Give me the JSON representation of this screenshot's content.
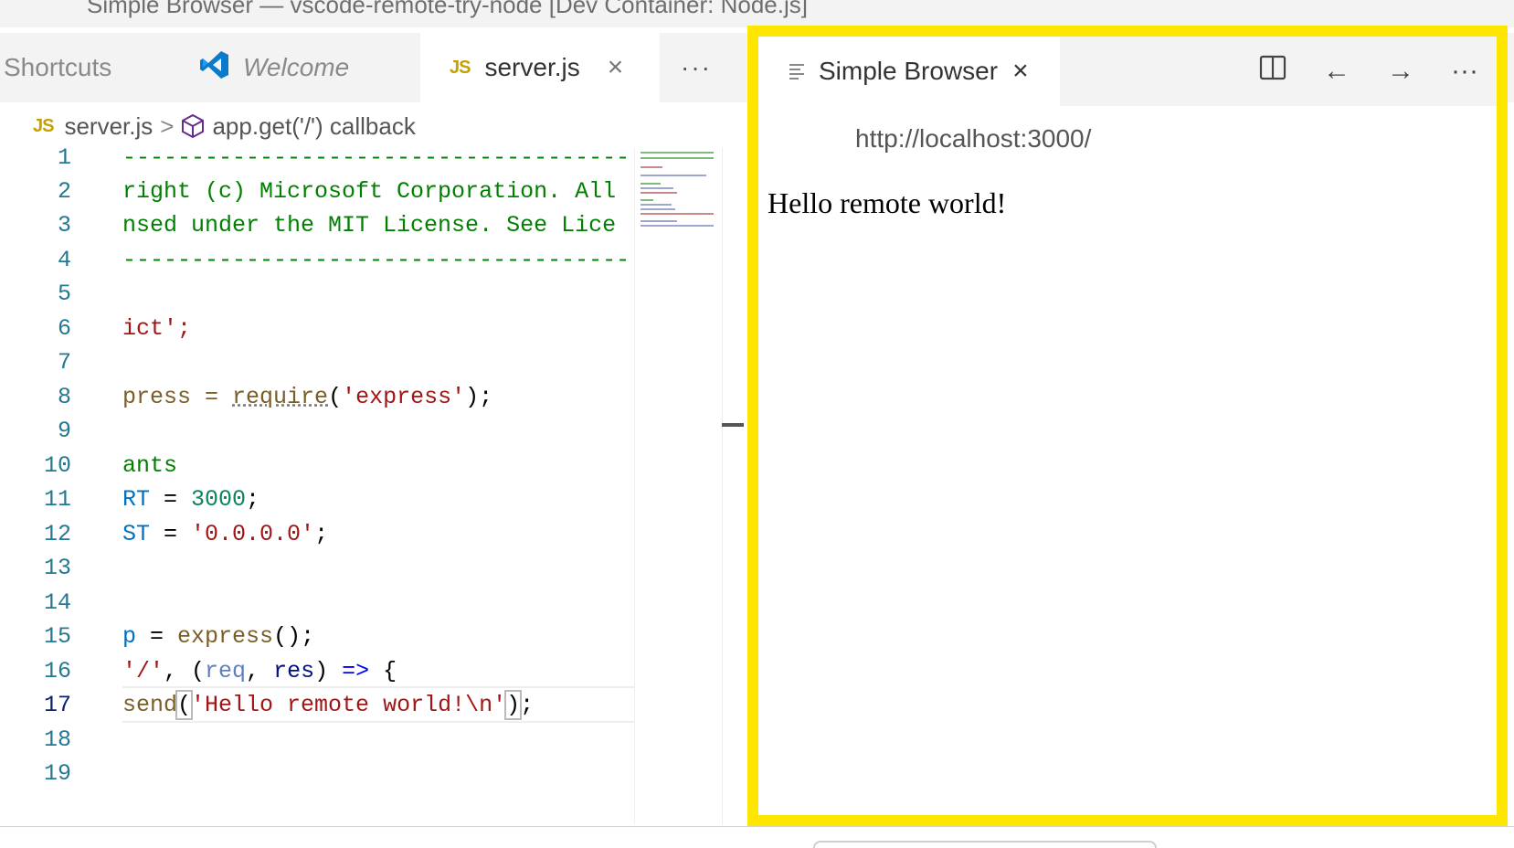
{
  "window": {
    "title": "Simple Browser — vscode-remote-try-node [Dev Container: Node.js]"
  },
  "editor_tabs": {
    "shortcuts": "Shortcuts",
    "welcome": "Welcome",
    "server": "server.js",
    "close_glyph": "×",
    "more_glyph": "···",
    "js_badge": "JS"
  },
  "breadcrumb": {
    "file": "server.js",
    "separator": ">",
    "symbol": "app.get('/') callback"
  },
  "code_lines": [
    {
      "n": "1",
      "text": "-------------------------------------"
    },
    {
      "n": "2",
      "text": "right (c) Microsoft Corporation. All"
    },
    {
      "n": "3",
      "text": "nsed under the MIT License. See Lice"
    },
    {
      "n": "4",
      "text": "-------------------------------------"
    },
    {
      "n": "5",
      "text": ""
    },
    {
      "n": "6",
      "text": "ict';"
    },
    {
      "n": "7",
      "text": ""
    },
    {
      "n": "8",
      "a": "press = ",
      "b": "require",
      "c": "(",
      "d": "'express'",
      "e": ");"
    },
    {
      "n": "9",
      "text": ""
    },
    {
      "n": "10",
      "text": "ants"
    },
    {
      "n": "11",
      "a": "RT",
      "b": " = ",
      "c": "3000",
      "d": ";"
    },
    {
      "n": "12",
      "a": "ST",
      "b": " = ",
      "c": "'0.0.0.0'",
      "d": ";"
    },
    {
      "n": "13",
      "text": ""
    },
    {
      "n": "14",
      "text": ""
    },
    {
      "n": "15",
      "a": "p",
      "b": " = ",
      "c": "express",
      "d": "();"
    },
    {
      "n": "16",
      "a": "'/'",
      "b": ", (",
      "c": "req",
      "d": ", ",
      "e": "res",
      "f": ") ",
      "g": "=>",
      "h": " {"
    },
    {
      "n": "17",
      "a": "send",
      "b": "(",
      "c": "'Hello remote world!\\n'",
      "d": ")",
      "e": ";"
    },
    {
      "n": "18",
      "text": ""
    },
    {
      "n": "19",
      "text": ""
    }
  ],
  "simple_browser": {
    "tab_label": "Simple Browser",
    "close_glyph": "×",
    "more_glyph": "···",
    "back_glyph": "←",
    "forward_glyph": "→",
    "url": "http://localhost:3000/",
    "page_text": "Hello remote world!"
  },
  "colors": {
    "highlight_border": "#ffe600",
    "comment": "#008000",
    "string": "#a31515",
    "variable": "#0070c1",
    "number": "#098658",
    "line_number": "#237893"
  },
  "icons": {
    "vscode": "vscode-logo-icon",
    "symbol": "method-cube-icon",
    "document": "document-lines-icon",
    "split": "split-editor-icon"
  }
}
